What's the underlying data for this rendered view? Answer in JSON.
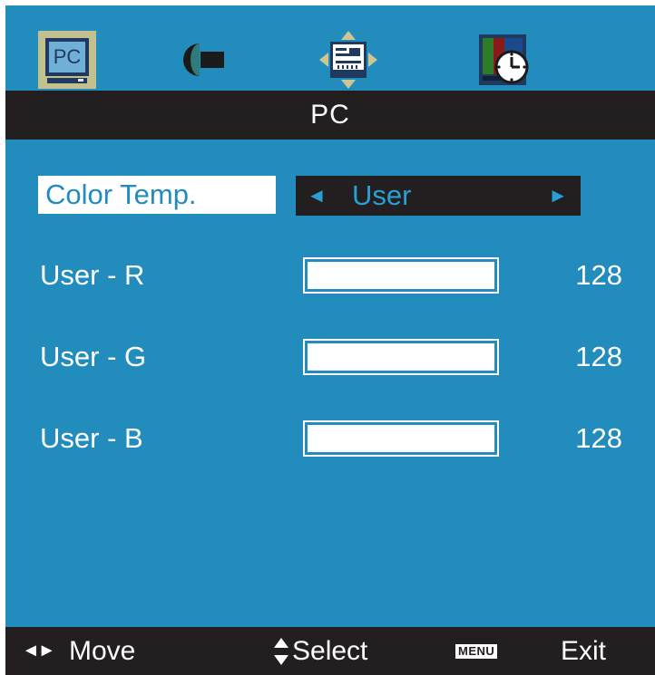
{
  "tabs": [
    {
      "id": "pc",
      "icon": "pc-monitor-icon",
      "label": "PC",
      "selected": true
    },
    {
      "id": "image",
      "icon": "image-settings-icon",
      "selected": false
    },
    {
      "id": "setup",
      "icon": "setup-move-icon",
      "selected": false
    },
    {
      "id": "time",
      "icon": "clock-icon",
      "selected": false
    }
  ],
  "title": "PC",
  "color_temp": {
    "label": "Color Temp.",
    "value": "User",
    "left_arrow": "◄",
    "right_arrow": "►"
  },
  "rows": [
    {
      "label": "User   -   R",
      "value": "128",
      "level": 1.0
    },
    {
      "label": "User   -   G",
      "value": "128",
      "level": 1.0
    },
    {
      "label": "User   -   B",
      "value": "128",
      "level": 1.0
    }
  ],
  "footer": {
    "move_icon": "◄►",
    "move_label": "Move",
    "select_label": "Select",
    "menu_key": "MENU",
    "exit_label": "Exit"
  },
  "colors": {
    "background": "#228cbd",
    "bar": "#231e1f",
    "highlight": "#ffffff",
    "accent": "#2a9fd6",
    "tab_selected": "#c2c08e"
  }
}
